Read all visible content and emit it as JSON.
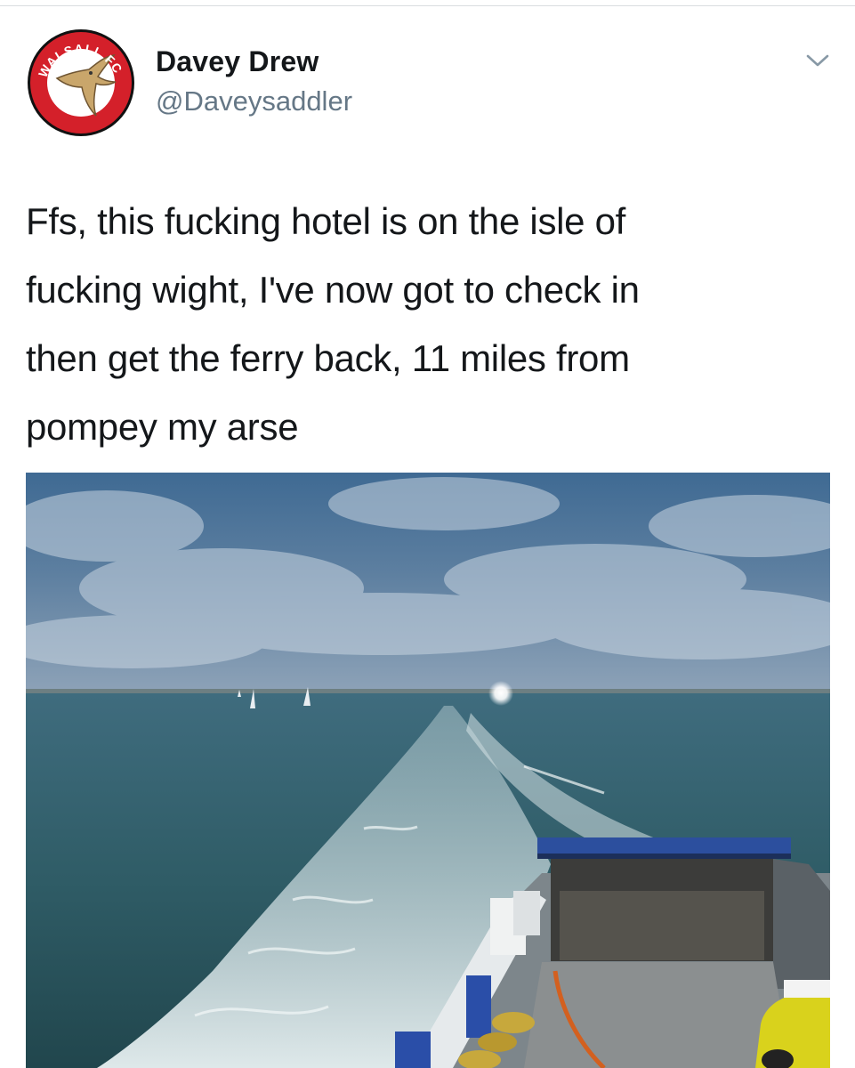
{
  "tweet": {
    "author": {
      "display_name": "Davey Drew",
      "handle": "@Daveysaddler",
      "avatar_badge_text": "WALSALL FC",
      "avatar_icon": "walsall-fc-swift-badge"
    },
    "menu_icon": "chevron-down-icon",
    "text": "Ffs, this fucking hotel is on the isle of\nfucking wight, I've now got to check in\nthen get the ferry back, 11 miles from\npompey my arse",
    "media": {
      "type": "photo",
      "subject": "view from ferry stern over the sea and wake"
    }
  },
  "colors": {
    "text_primary": "#14171a",
    "text_secondary": "#657786",
    "badge_red": "#d4202a",
    "badge_tan": "#c9a66b",
    "sky": "#4a6f92",
    "sea": "#2e5a66"
  }
}
